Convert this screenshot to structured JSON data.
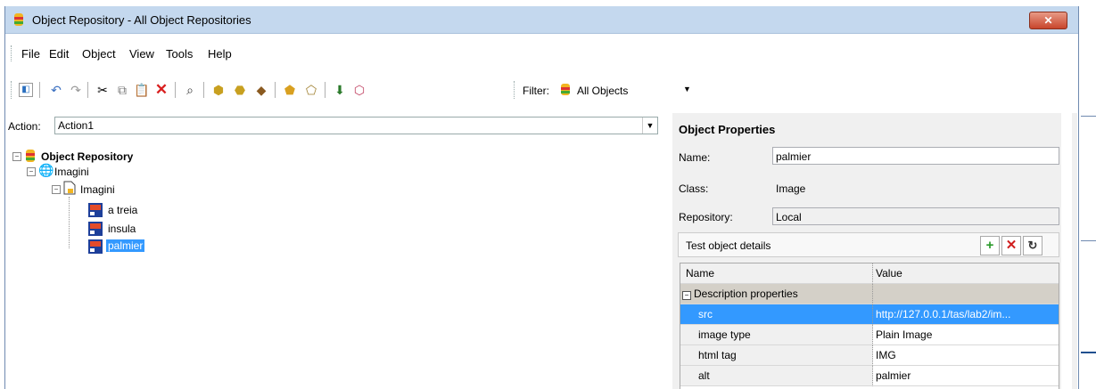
{
  "window": {
    "title": "Object Repository - All Object Repositories",
    "close_label": "✕"
  },
  "menu": [
    "File",
    "Edit",
    "Object",
    "View",
    "Tools",
    "Help"
  ],
  "toolbar": {
    "filter_label": "Filter:",
    "filter_value": "All Objects"
  },
  "action": {
    "label": "Action:",
    "value": "Action1"
  },
  "tree": {
    "root": "Object Repository",
    "browser": "Imagini",
    "page": "Imagini",
    "items": [
      "a treia",
      "insula",
      "palmier"
    ],
    "selected": "palmier"
  },
  "properties": {
    "title": "Object Properties",
    "name_label": "Name:",
    "name_value": "palmier",
    "class_label": "Class:",
    "class_value": "Image",
    "repository_label": "Repository:",
    "repository_value": "Local",
    "details_title": "Test object details",
    "grid": {
      "headers": [
        "Name",
        "Value"
      ],
      "section": "Description properties",
      "rows": [
        {
          "name": "src",
          "value": "http://127.0.0.1/tas/lab2/im..."
        },
        {
          "name": "image type",
          "value": "Plain Image"
        },
        {
          "name": "html tag",
          "value": "IMG"
        },
        {
          "name": "alt",
          "value": "palmier"
        }
      ]
    }
  }
}
